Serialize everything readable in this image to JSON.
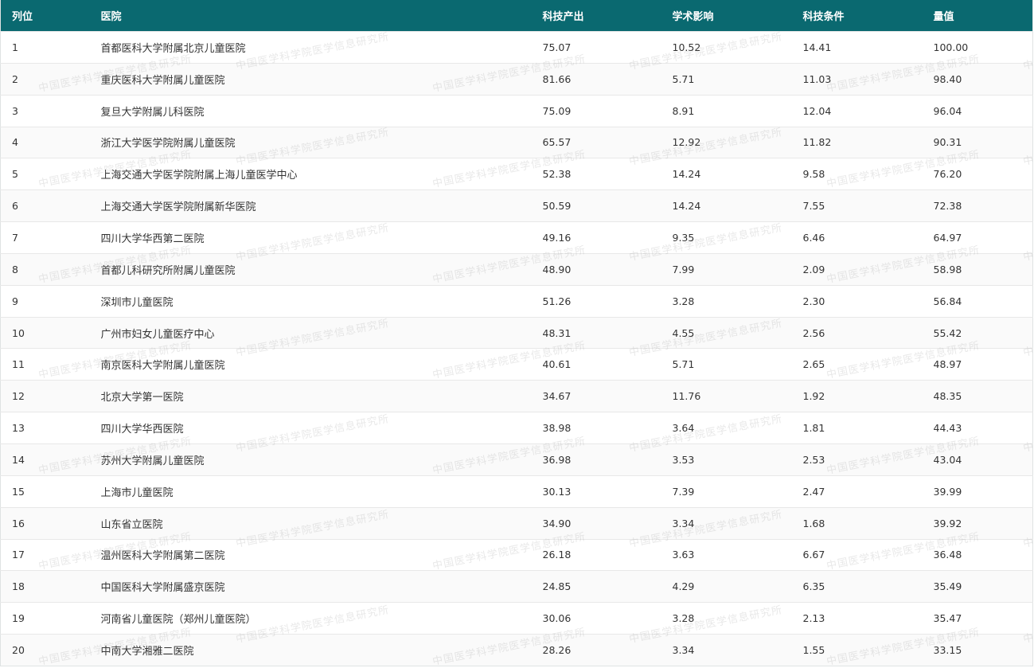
{
  "table": {
    "headers": {
      "rank": "列位",
      "hospital": "医院",
      "tech_output": "科技产出",
      "academic_impact": "学术影响",
      "tech_condition": "科技条件",
      "value": "量值"
    },
    "rows": [
      {
        "rank": "1",
        "hospital": "首都医科大学附属北京儿童医院",
        "tech_output": "75.07",
        "academic_impact": "10.52",
        "tech_condition": "14.41",
        "value": "100.00"
      },
      {
        "rank": "2",
        "hospital": "重庆医科大学附属儿童医院",
        "tech_output": "81.66",
        "academic_impact": "5.71",
        "tech_condition": "11.03",
        "value": "98.40"
      },
      {
        "rank": "3",
        "hospital": "复旦大学附属儿科医院",
        "tech_output": "75.09",
        "academic_impact": "8.91",
        "tech_condition": "12.04",
        "value": "96.04"
      },
      {
        "rank": "4",
        "hospital": "浙江大学医学院附属儿童医院",
        "tech_output": "65.57",
        "academic_impact": "12.92",
        "tech_condition": "11.82",
        "value": "90.31"
      },
      {
        "rank": "5",
        "hospital": "上海交通大学医学院附属上海儿童医学中心",
        "tech_output": "52.38",
        "academic_impact": "14.24",
        "tech_condition": "9.58",
        "value": "76.20"
      },
      {
        "rank": "6",
        "hospital": "上海交通大学医学院附属新华医院",
        "tech_output": "50.59",
        "academic_impact": "14.24",
        "tech_condition": "7.55",
        "value": "72.38"
      },
      {
        "rank": "7",
        "hospital": "四川大学华西第二医院",
        "tech_output": "49.16",
        "academic_impact": "9.35",
        "tech_condition": "6.46",
        "value": "64.97"
      },
      {
        "rank": "8",
        "hospital": "首都儿科研究所附属儿童医院",
        "tech_output": "48.90",
        "academic_impact": "7.99",
        "tech_condition": "2.09",
        "value": "58.98"
      },
      {
        "rank": "9",
        "hospital": "深圳市儿童医院",
        "tech_output": "51.26",
        "academic_impact": "3.28",
        "tech_condition": "2.30",
        "value": "56.84"
      },
      {
        "rank": "10",
        "hospital": "广州市妇女儿童医疗中心",
        "tech_output": "48.31",
        "academic_impact": "4.55",
        "tech_condition": "2.56",
        "value": "55.42"
      },
      {
        "rank": "11",
        "hospital": "南京医科大学附属儿童医院",
        "tech_output": "40.61",
        "academic_impact": "5.71",
        "tech_condition": "2.65",
        "value": "48.97"
      },
      {
        "rank": "12",
        "hospital": "北京大学第一医院",
        "tech_output": "34.67",
        "academic_impact": "11.76",
        "tech_condition": "1.92",
        "value": "48.35"
      },
      {
        "rank": "13",
        "hospital": "四川大学华西医院",
        "tech_output": "38.98",
        "academic_impact": "3.64",
        "tech_condition": "1.81",
        "value": "44.43"
      },
      {
        "rank": "14",
        "hospital": "苏州大学附属儿童医院",
        "tech_output": "36.98",
        "academic_impact": "3.53",
        "tech_condition": "2.53",
        "value": "43.04"
      },
      {
        "rank": "15",
        "hospital": "上海市儿童医院",
        "tech_output": "30.13",
        "academic_impact": "7.39",
        "tech_condition": "2.47",
        "value": "39.99"
      },
      {
        "rank": "16",
        "hospital": "山东省立医院",
        "tech_output": "34.90",
        "academic_impact": "3.34",
        "tech_condition": "1.68",
        "value": "39.92"
      },
      {
        "rank": "17",
        "hospital": "温州医科大学附属第二医院",
        "tech_output": "26.18",
        "academic_impact": "3.63",
        "tech_condition": "6.67",
        "value": "36.48"
      },
      {
        "rank": "18",
        "hospital": "中国医科大学附属盛京医院",
        "tech_output": "24.85",
        "academic_impact": "4.29",
        "tech_condition": "6.35",
        "value": "35.49"
      },
      {
        "rank": "19",
        "hospital": "河南省儿童医院（郑州儿童医院）",
        "tech_output": "30.06",
        "academic_impact": "3.28",
        "tech_condition": "2.13",
        "value": "35.47"
      },
      {
        "rank": "20",
        "hospital": "中南大学湘雅二医院",
        "tech_output": "28.26",
        "academic_impact": "3.34",
        "tech_condition": "1.55",
        "value": "33.15"
      }
    ]
  },
  "watermark": {
    "text": "中国医学科学院医学信息研究所"
  },
  "colors": {
    "header_bg": "#0a6970",
    "header_text": "#ffffff",
    "row_alt_bg": "#fafafa",
    "text": "#333333"
  }
}
